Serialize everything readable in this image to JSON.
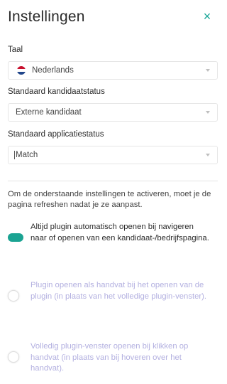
{
  "header": {
    "title": "Instellingen",
    "close_glyph": "×"
  },
  "language": {
    "label": "Taal",
    "value": "Nederlands",
    "flag_icon": "netherlands-flag-icon"
  },
  "candidate_status": {
    "label": "Standaard kandidaatstatus",
    "value": "Externe kandidaat"
  },
  "application_status": {
    "label": "Standaard applicatiestatus",
    "value": "Match"
  },
  "note": "Om de onderstaande instellingen te activeren, moet je de pagina refreshen nadat je ze aanpast.",
  "options": [
    {
      "text": "Altijd plugin automatisch openen bij navigeren naar of openen van een kandidaat-/bedrijfspagina.",
      "enabled": true
    },
    {
      "text": "Plugin openen als handvat bij het openen van de plugin (in plaats van het volledige plugin-venster).",
      "enabled": false
    },
    {
      "text": "Volledig plugin-venster openen bij klikken op handvat (in plaats van bij hoveren over het handvat).",
      "enabled": false
    }
  ],
  "colors": {
    "accent": "#1aa392",
    "disabled_text": "#b3b0e0"
  }
}
